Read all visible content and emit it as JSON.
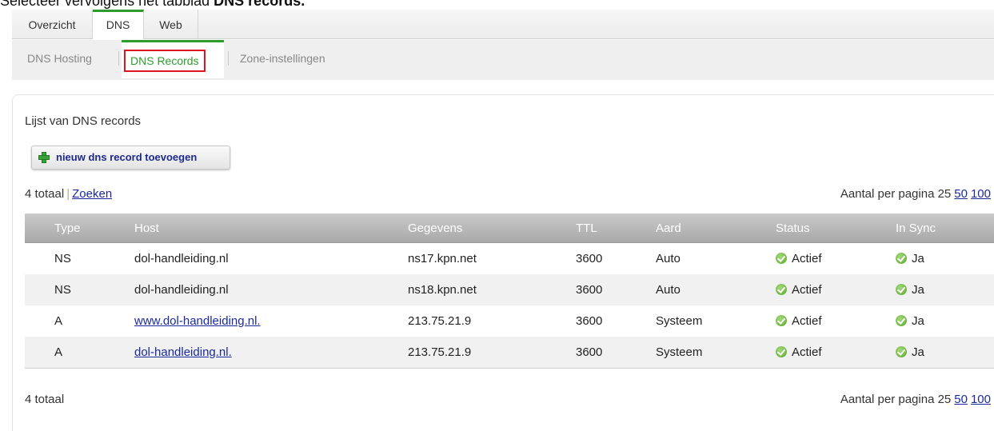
{
  "instruction": {
    "prefix": "Selecteer vervolgens het tabblad ",
    "bold": "DNS records."
  },
  "tabs": [
    "Overzicht",
    "DNS",
    "Web"
  ],
  "subtabs": [
    "DNS Hosting",
    "DNS Records",
    "Zone-instellingen"
  ],
  "list_title": "Lijst van DNS records",
  "add_button": "nieuw dns record toevoegen",
  "totals": {
    "count": "4 totaal",
    "search": "Zoeken"
  },
  "perpage": {
    "label": "Aantal per pagina 25",
    "opt50": "50",
    "opt100": "100"
  },
  "columns": [
    "Type",
    "Host",
    "Gegevens",
    "TTL",
    "Aard",
    "Status",
    "In Sync"
  ],
  "rows": [
    {
      "type": "NS",
      "host": "dol-handleiding.nl",
      "host_link": false,
      "data": "ns17.kpn.net",
      "ttl": "3600",
      "kind": "Auto",
      "status": "Actief",
      "sync": "Ja"
    },
    {
      "type": "NS",
      "host": "dol-handleiding.nl",
      "host_link": false,
      "data": "ns18.kpn.net",
      "ttl": "3600",
      "kind": "Auto",
      "status": "Actief",
      "sync": "Ja"
    },
    {
      "type": "A",
      "host": "www.dol-handleiding.nl.",
      "host_link": true,
      "data": "213.75.21.9",
      "ttl": "3600",
      "kind": "Systeem",
      "status": "Actief",
      "sync": "Ja"
    },
    {
      "type": "A",
      "host": "dol-handleiding.nl.",
      "host_link": true,
      "data": "213.75.21.9",
      "ttl": "3600",
      "kind": "Systeem",
      "status": "Actief",
      "sync": "Ja"
    }
  ],
  "colors": {
    "accent_green": "#2e9b2e",
    "highlight_red": "#e0141e",
    "link_blue": "#1a2a9c"
  }
}
